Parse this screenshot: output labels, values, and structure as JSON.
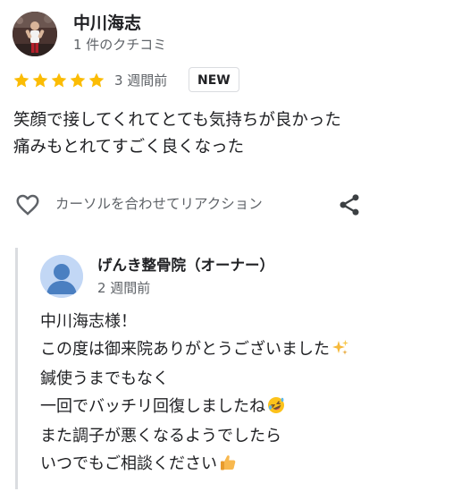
{
  "reviewer": {
    "name": "中川海志",
    "review_count": "1 件のクチコミ"
  },
  "rating": {
    "stars": 5,
    "max": 5,
    "color": "#fbbc04",
    "time": "3 週間前",
    "badge": "NEW"
  },
  "review": {
    "lines": [
      "笑顔で接してくれてとても気持ちが良かった",
      "痛みもとれてすごく良くなった"
    ]
  },
  "actions": {
    "react_label": "カーソルを合わせてリアクション",
    "heart_icon": "heart-outline-icon",
    "share_icon": "share-icon"
  },
  "owner_reply": {
    "name": "げんき整骨院（オーナー）",
    "time": "2 週間前",
    "avatar_color": "#4a7fc1",
    "lines": [
      "中川海志様！",
      "この度は御来院ありがとうございました",
      "鍼使うまでもなく",
      "一回でバッチリ回復しましたね",
      "また調子が悪くなるようでしたら",
      "いつでもご相談ください"
    ],
    "line_emojis": [
      "",
      "sparkles-emoji",
      "",
      "rolling-laughing-emoji",
      "",
      "thumbs-up-emoji"
    ]
  }
}
